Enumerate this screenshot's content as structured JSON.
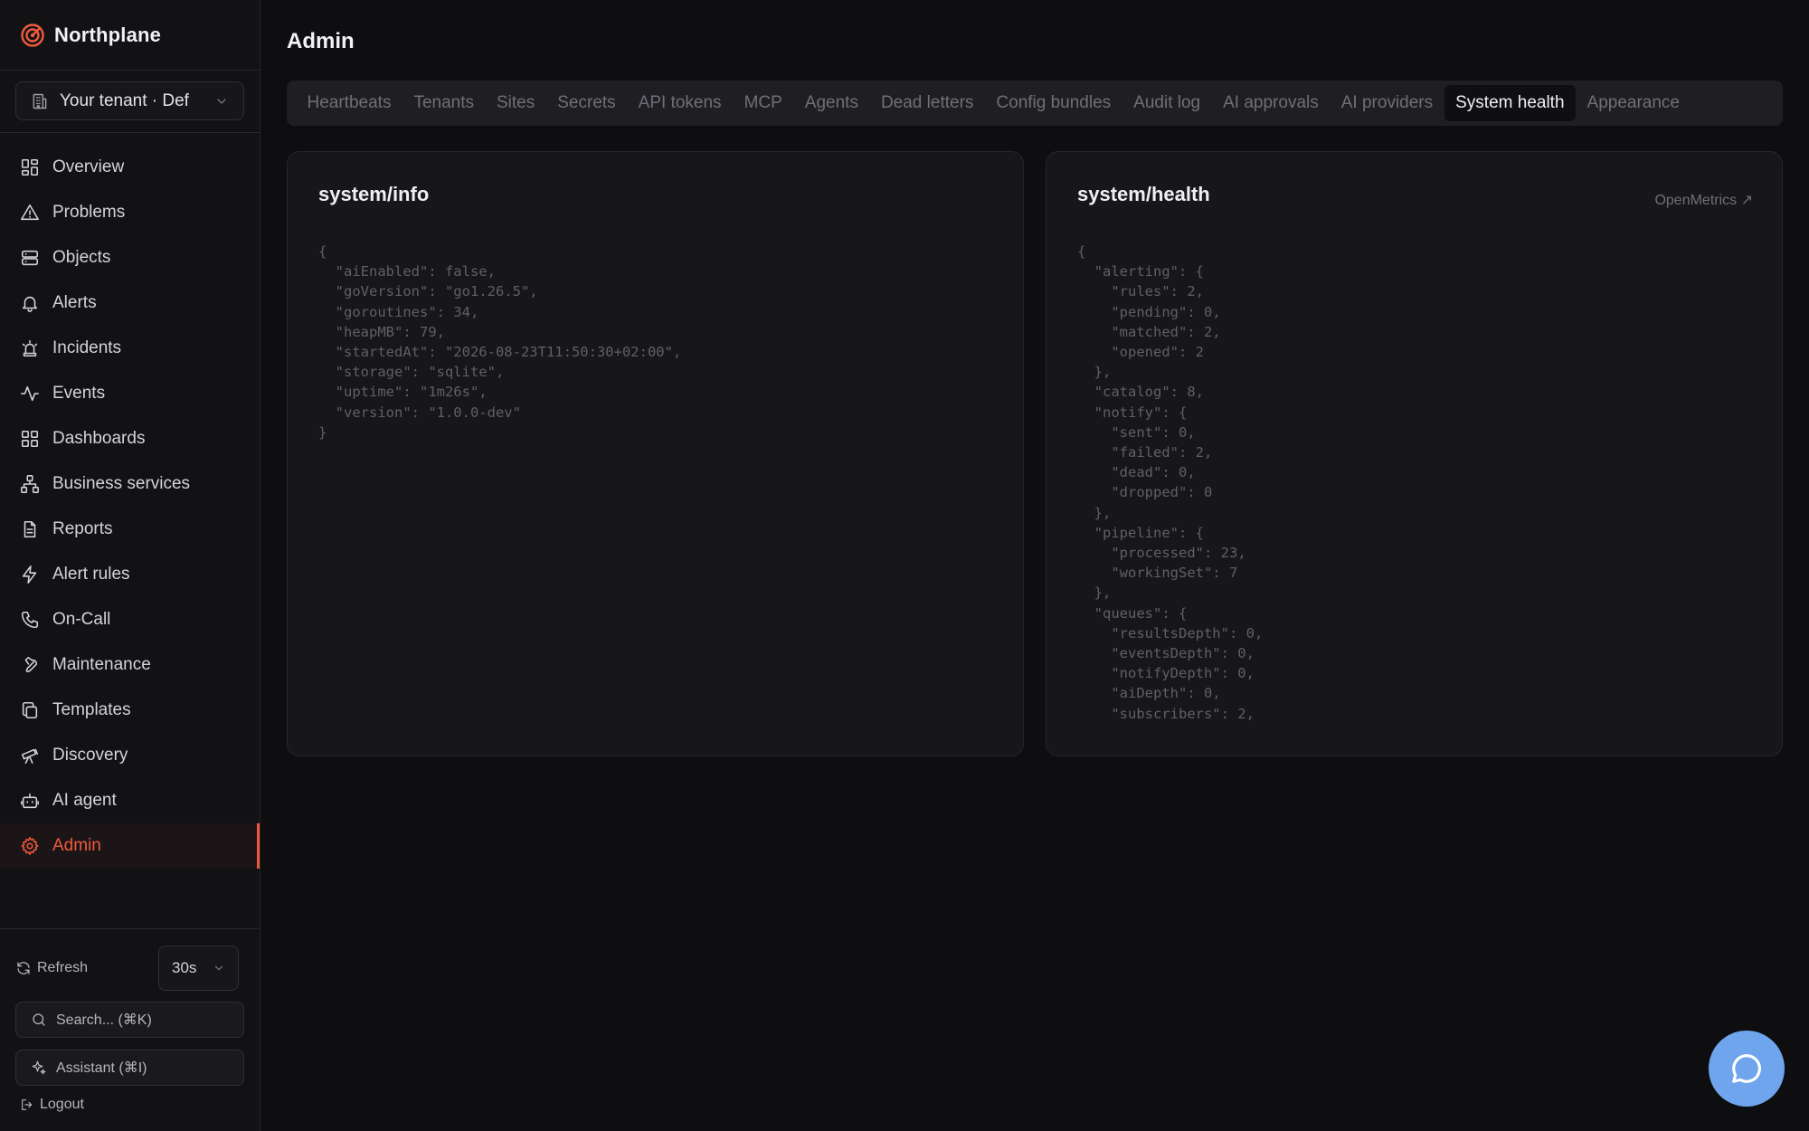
{
  "app": {
    "name": "Northplane"
  },
  "tenant": {
    "label": "Your tenant · Def"
  },
  "sidebar": {
    "items": [
      {
        "label": "Overview",
        "icon": "grid-icon"
      },
      {
        "label": "Problems",
        "icon": "warning-icon"
      },
      {
        "label": "Objects",
        "icon": "server-icon"
      },
      {
        "label": "Alerts",
        "icon": "bell-icon"
      },
      {
        "label": "Incidents",
        "icon": "siren-icon"
      },
      {
        "label": "Events",
        "icon": "activity-icon"
      },
      {
        "label": "Dashboards",
        "icon": "dashboard-icon"
      },
      {
        "label": "Business services",
        "icon": "network-icon"
      },
      {
        "label": "Reports",
        "icon": "document-icon"
      },
      {
        "label": "Alert rules",
        "icon": "bolt-icon"
      },
      {
        "label": "On-Call",
        "icon": "phone-icon"
      },
      {
        "label": "Maintenance",
        "icon": "wrench-icon"
      },
      {
        "label": "Templates",
        "icon": "copy-icon"
      },
      {
        "label": "Discovery",
        "icon": "telescope-icon"
      },
      {
        "label": "AI agent",
        "icon": "bot-icon"
      },
      {
        "label": "Admin",
        "icon": "gear-icon",
        "active": true
      }
    ],
    "refresh_label": "Refresh",
    "interval": "30s",
    "search_label": "Search... (⌘K)",
    "assistant_label": "Assistant (⌘I)",
    "logout_label": "Logout"
  },
  "page": {
    "title": "Admin"
  },
  "tabs": [
    "Heartbeats",
    "Tenants",
    "Sites",
    "Secrets",
    "API tokens",
    "MCP",
    "Agents",
    "Dead letters",
    "Config bundles",
    "Audit log",
    "AI approvals",
    "AI providers",
    "System health",
    "Appearance"
  ],
  "active_tab": "System health",
  "cards": {
    "info": {
      "title": "system/info",
      "json": "{\n  \"aiEnabled\": false,\n  \"goVersion\": \"go1.26.5\",\n  \"goroutines\": 34,\n  \"heapMB\": 79,\n  \"startedAt\": \"2026-08-23T11:50:30+02:00\",\n  \"storage\": \"sqlite\",\n  \"uptime\": \"1m26s\",\n  \"version\": \"1.0.0-dev\"\n}"
    },
    "health": {
      "title": "system/health",
      "link_label": "OpenMetrics ↗",
      "json": "{\n  \"alerting\": {\n    \"rules\": 2,\n    \"pending\": 0,\n    \"matched\": 2,\n    \"opened\": 2\n  },\n  \"catalog\": 8,\n  \"notify\": {\n    \"sent\": 0,\n    \"failed\": 2,\n    \"dead\": 0,\n    \"dropped\": 0\n  },\n  \"pipeline\": {\n    \"processed\": 23,\n    \"workingSet\": 7\n  },\n  \"queues\": {\n    \"resultsDepth\": 0,\n    \"eventsDepth\": 0,\n    \"notifyDepth\": 0,\n    \"aiDepth\": 0,\n    \"subscribers\": 2,"
    }
  },
  "colors": {
    "accent": "#ef5a3c",
    "fab": "#6ea5ec",
    "background": "#0e0e11"
  }
}
